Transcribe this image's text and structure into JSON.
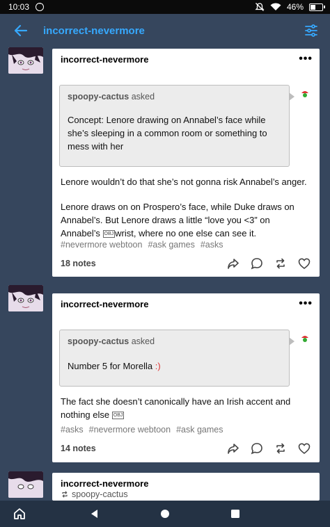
{
  "status": {
    "time": "10:03",
    "battery": "46%",
    "battery_level": 0.46
  },
  "header": {
    "title": "incorrect-nevermore"
  },
  "posts": [
    {
      "author": "incorrect-nevermore",
      "asker": "spoopy-cactus",
      "asked_label": "asked",
      "question": "Concept: Lenore drawing on Annabel’s face while she’s sleeping in a common room or something to mess with her",
      "answer_1": "Lenore wouldn’t do that she’s not gonna risk Annabel’s anger.",
      "answer_2": "Lenore draws on on Prospero’s face, while Duke draws on Annabel’s. But Lenore draws a little “love you <3” on Annabel’s",
      "answer_2_tail": "wrist, where no one else can see it.",
      "tags": [
        "#nevermore webtoon",
        "#ask games",
        "#asks"
      ],
      "notes": "18 notes"
    },
    {
      "author": "incorrect-nevermore",
      "asker": "spoopy-cactus",
      "asked_label": "asked",
      "question_main": "Number 5 for Morella ",
      "question_emoji": ":)",
      "answer_1": "The fact she doesn’t canonically have an Irish accent and nothing else",
      "tags": [
        "#asks",
        "#nevermore webtoon",
        "#ask games"
      ],
      "notes": "14 notes"
    },
    {
      "author": "incorrect-nevermore",
      "reblogged_from": "spoopy-cactus"
    }
  ],
  "tofu_glyph": "OBJ",
  "colors": {
    "background": "#36465d",
    "accent": "#36a9ff",
    "card": "#ffffff",
    "navbar": "#243244"
  }
}
